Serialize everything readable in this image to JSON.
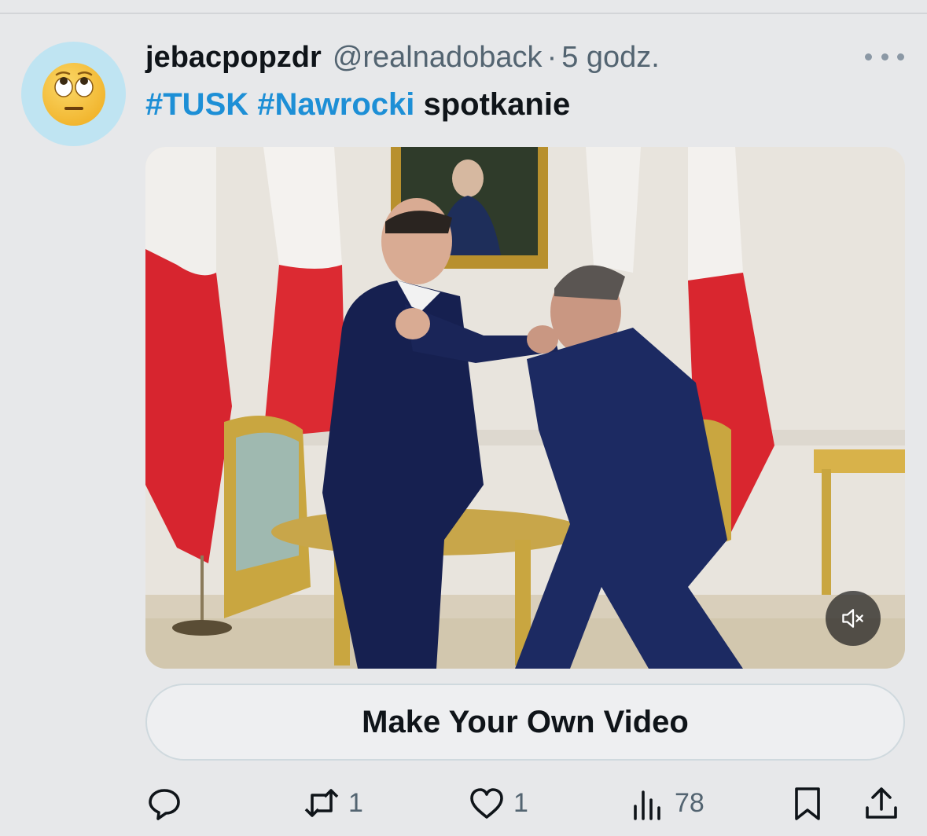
{
  "tweet": {
    "display_name": "jebacpopzdr",
    "handle": "@realnadoback",
    "separator": "·",
    "time": "5 godz.",
    "text": {
      "hashtag1": "#TUSK",
      "hashtag2": "#Nawrocki",
      "word": "spotkanie"
    },
    "avatar_icon": "face-with-rolling-eyes-emoji",
    "more_icon": "more-horizontal-icon"
  },
  "media": {
    "type": "video",
    "mute_icon": "volume-muted-icon"
  },
  "cta": {
    "label": "Make Your Own Video"
  },
  "actions": {
    "reply": {
      "icon": "reply-icon",
      "count": ""
    },
    "retweet": {
      "icon": "retweet-icon",
      "count": "1"
    },
    "like": {
      "icon": "heart-icon",
      "count": "1"
    },
    "views": {
      "icon": "views-bar-chart-icon",
      "count": "78"
    },
    "bookmark": {
      "icon": "bookmark-icon"
    },
    "share": {
      "icon": "share-icon"
    }
  },
  "colors": {
    "background": "#e7e8ea",
    "hashtag": "#1d8fd6",
    "muted_text": "#536471",
    "avatar_bg": "#bfe4f2"
  }
}
